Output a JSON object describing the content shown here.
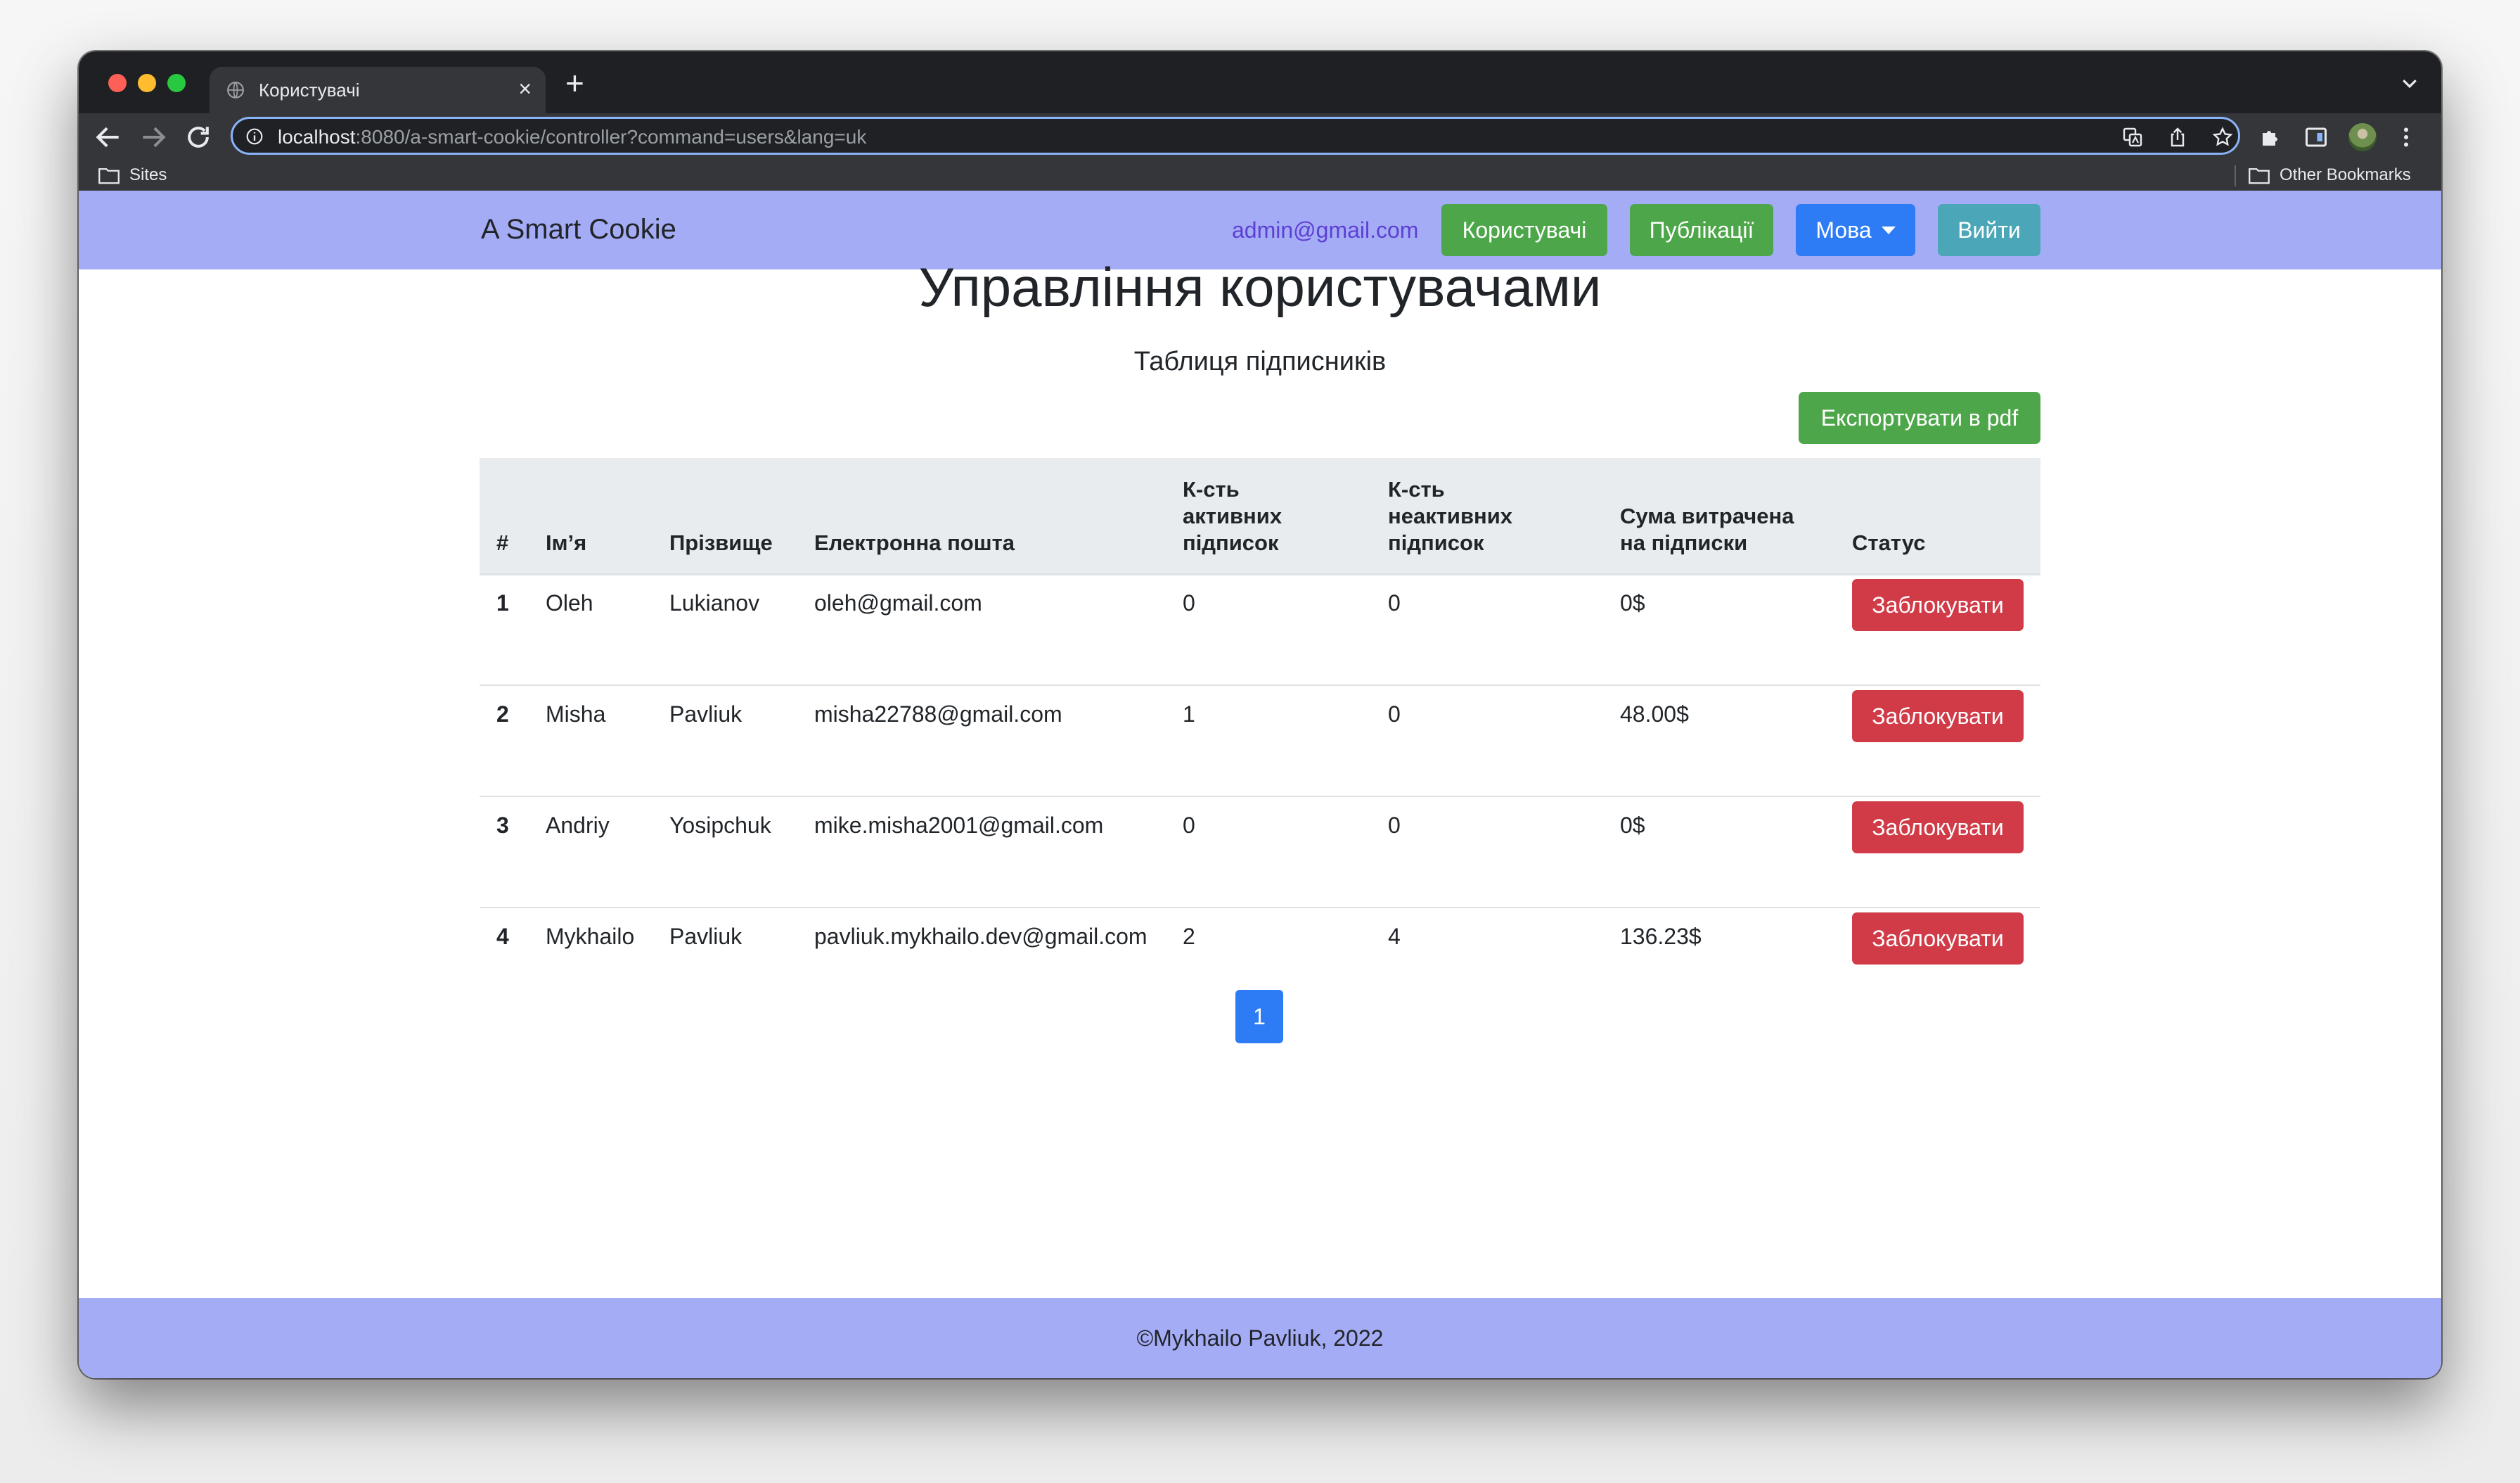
{
  "browser": {
    "tab_title": "Користувачі",
    "url_host": "localhost",
    "url_rest": ":8080/a-smart-cookie/controller?command=users&lang=uk",
    "bookmarks": [
      "Sites"
    ],
    "other_bookmarks": "Other Bookmarks"
  },
  "navbar": {
    "brand": "A Smart Cookie",
    "email": "admin@gmail.com",
    "users_label": "Користувачі",
    "publications_label": "Публікації",
    "language_label": "Мова",
    "logout_label": "Вийти"
  },
  "main": {
    "title": "Управління користувачами",
    "subtitle": "Таблиця підписників",
    "export_label": "Експортувати в pdf",
    "columns": {
      "num": "#",
      "name": "Ім’я",
      "surname": "Прізвище",
      "email": "Електронна пошта",
      "active_1": "К-сть",
      "active_2": "активних",
      "active_3": "підписок",
      "inactive_1": "К-сть",
      "inactive_2": "неактивних",
      "inactive_3": "підписок",
      "spent_1": "Сума витрачена",
      "spent_2": "на підписки",
      "status": "Статус"
    },
    "rows": [
      {
        "num": "1",
        "name": "Oleh",
        "surname": "Lukianov",
        "email": "oleh@gmail.com",
        "active": "0",
        "inactive": "0",
        "spent": "0$",
        "action": "Заблокувати"
      },
      {
        "num": "2",
        "name": "Misha",
        "surname": "Pavliuk",
        "email": "misha22788@gmail.com",
        "active": "1",
        "inactive": "0",
        "spent": "48.00$",
        "action": "Заблокувати"
      },
      {
        "num": "3",
        "name": "Andriy",
        "surname": "Yosipchuk",
        "email": "mike.misha2001@gmail.com",
        "active": "0",
        "inactive": "0",
        "spent": "0$",
        "action": "Заблокувати"
      },
      {
        "num": "4",
        "name": "Mykhailo",
        "surname": "Pavliuk",
        "email": "pavliuk.mykhailo.dev@gmail.com",
        "active": "2",
        "inactive": "4",
        "spent": "136.23$",
        "action": "Заблокувати"
      }
    ],
    "page": "1"
  },
  "footer": {
    "text": "©Mykhailo Pavliuk, 2022"
  },
  "colors": {
    "navbar_bg": "#a5acf6",
    "green": "#4ea64a",
    "blue": "#2d7cf6",
    "teal": "#4ba6b7",
    "red": "#d03b47",
    "email_link": "#5d3fd3"
  },
  "icons": [
    "globe-icon",
    "close-icon",
    "plus-icon",
    "chevron-down-icon",
    "back-icon",
    "forward-icon",
    "reload-icon",
    "info-icon",
    "translate-icon",
    "share-icon",
    "star-icon",
    "puzzle-icon",
    "sidepanel-icon",
    "menu-dots-icon",
    "folder-icon"
  ]
}
